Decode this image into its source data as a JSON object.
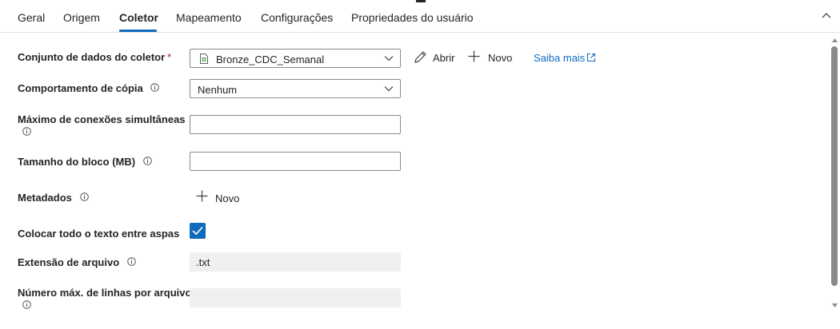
{
  "tabs": [
    {
      "label": "Geral"
    },
    {
      "label": "Origem"
    },
    {
      "label": "Coletor"
    },
    {
      "label": "Mapeamento"
    },
    {
      "label": "Configurações"
    },
    {
      "label": "Propriedades do usuário"
    }
  ],
  "active_tab": "Coletor",
  "sink": {
    "dataset_label": "Conjunto de dados do coletor",
    "required_mark": "*",
    "dataset_value": "Bronze_CDC_Semanal",
    "open_label": "Abrir",
    "new_label": "Novo",
    "learn_more_label": "Saiba mais",
    "copy_behavior_label": "Comportamento de cópia",
    "copy_behavior_value": "Nenhum",
    "max_connections_label": "Máximo de conexões simultâneas",
    "max_connections_value": "",
    "block_size_label": "Tamanho do bloco (MB)",
    "block_size_value": "",
    "metadata_label": "Metadados",
    "metadata_new_label": "Novo",
    "quote_all_label": "Colocar todo o texto entre aspas",
    "quote_all_checked": true,
    "file_extension_label": "Extensão de arquivo",
    "file_extension_value": ".txt",
    "max_rows_label": "Número máx. de linhas por arquivo",
    "max_rows_value": ""
  },
  "colors": {
    "accent": "#0f6cbd",
    "required": "#c50f1f",
    "disabled_field": "#f0f0f0"
  }
}
